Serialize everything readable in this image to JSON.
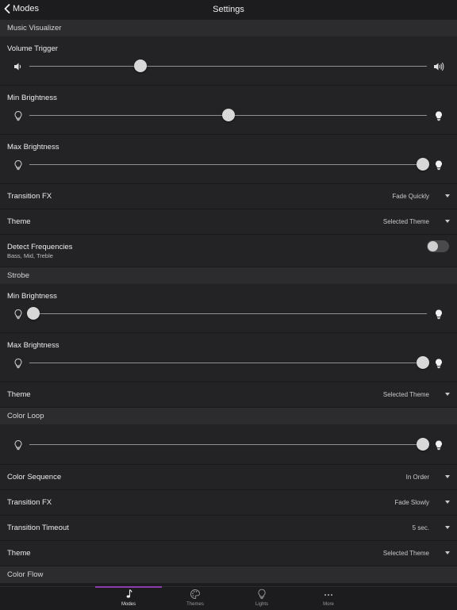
{
  "nav": {
    "back_label": "Modes",
    "title": "Settings"
  },
  "music_visualizer": {
    "section_title": "Music Visualizer",
    "volume_trigger": {
      "label": "Volume Trigger",
      "value": 0.28
    },
    "min_brightness": {
      "label": "Min Brightness",
      "value": 0.5
    },
    "max_brightness": {
      "label": "Max Brightness",
      "value": 0.99
    },
    "transition_fx": {
      "label": "Transition FX",
      "value": "Fade Quickly"
    },
    "theme": {
      "label": "Theme",
      "value": "Selected Theme"
    },
    "detect_frequencies": {
      "label": "Detect Frequencies",
      "sublabel": "Bass, Mid, Treble",
      "on": false
    }
  },
  "strobe": {
    "section_title": "Strobe",
    "min_brightness": {
      "label": "Min Brightness",
      "value": 0.01
    },
    "max_brightness": {
      "label": "Max Brightness",
      "value": 0.99
    },
    "theme": {
      "label": "Theme",
      "value": "Selected Theme"
    }
  },
  "color_loop": {
    "section_title": "Color Loop",
    "brightness": {
      "value": 0.99
    },
    "color_sequence": {
      "label": "Color Sequence",
      "value": "In Order"
    },
    "transition_fx": {
      "label": "Transition FX",
      "value": "Fade Slowly"
    },
    "transition_timeout": {
      "label": "Transition Timeout",
      "value": "5 sec."
    },
    "theme": {
      "label": "Theme",
      "value": "Selected Theme"
    }
  },
  "color_flow": {
    "section_title": "Color Flow"
  },
  "tabs": [
    {
      "label": "Modes",
      "icon": "music-note-icon",
      "active": true
    },
    {
      "label": "Themes",
      "icon": "palette-icon",
      "active": false
    },
    {
      "label": "Lights",
      "icon": "lightbulb-icon",
      "active": false
    },
    {
      "label": "More",
      "icon": "more-dots-icon",
      "active": false
    }
  ],
  "colors": {
    "accent": "#8b3ca8",
    "background": "#1c1c1e",
    "row": "#232325",
    "section": "#2c2c2e"
  }
}
